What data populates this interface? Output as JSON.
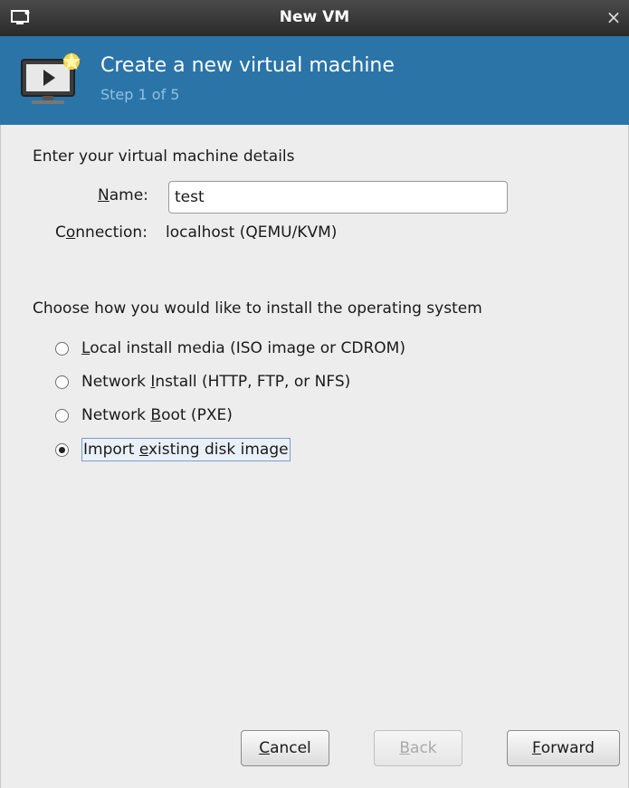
{
  "window": {
    "title": "New VM",
    "close_glyph": "×"
  },
  "banner": {
    "title": "Create a new virtual machine",
    "step": "Step 1 of 5",
    "icon": "vm-screen-icon"
  },
  "details": {
    "heading": "Enter your virtual machine details",
    "name_label_mnemonic": "N",
    "name_label_rest": "ame:",
    "name_value": "test",
    "connection_label_pre": "C",
    "connection_label_mnemonic": "o",
    "connection_label_rest": "nnection:",
    "connection_value": "localhost (QEMU/KVM)"
  },
  "install": {
    "heading": "Choose how you would like to install the operating system",
    "options": [
      {
        "pre": "",
        "mnemonic": "L",
        "rest": "ocal install media (ISO image or CDROM)",
        "checked": false
      },
      {
        "pre": "Network ",
        "mnemonic": "I",
        "rest": "nstall (HTTP, FTP, or NFS)",
        "checked": false
      },
      {
        "pre": "Network ",
        "mnemonic": "B",
        "rest": "oot (PXE)",
        "checked": false
      },
      {
        "pre": "Import ",
        "mnemonic": "e",
        "rest": "xisting disk image",
        "checked": true
      }
    ]
  },
  "buttons": {
    "cancel_mnemonic": "C",
    "cancel_rest": "ancel",
    "back_mnemonic": "B",
    "back_rest": "ack",
    "back_enabled": false,
    "forward_mnemonic": "F",
    "forward_rest": "orward"
  },
  "colors": {
    "banner_bg": "#2a74a8",
    "banner_step_text": "#8ec1e4",
    "titlebar_bg": "#333333"
  }
}
